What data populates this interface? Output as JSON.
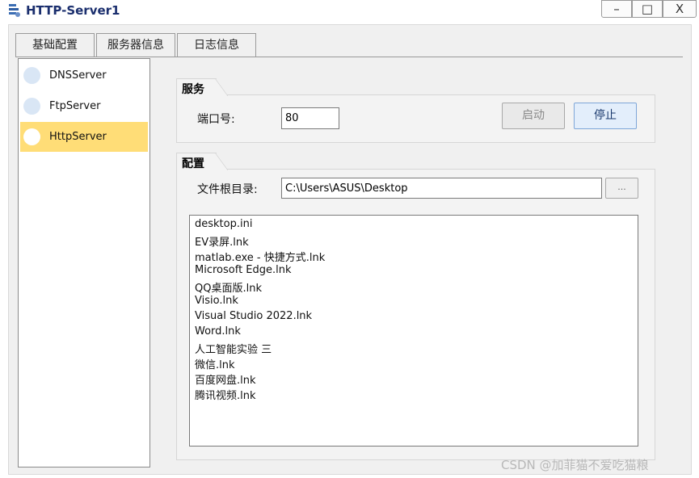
{
  "window": {
    "title": "HTTP-Server1",
    "icon": "server-app-icon",
    "controls": {
      "minimize": "–",
      "maximize": "□",
      "close": "X"
    }
  },
  "tabs": [
    {
      "label": "基础配置",
      "active": true
    },
    {
      "label": "服务器信息",
      "active": false
    },
    {
      "label": "日志信息",
      "active": false
    }
  ],
  "servers": [
    {
      "label": "DNSServer",
      "selected": false
    },
    {
      "label": "FtpServer",
      "selected": false
    },
    {
      "label": "HttpServer",
      "selected": true
    }
  ],
  "service": {
    "title": "服务",
    "port_label": "端口号:",
    "port_value": "80",
    "start_label": "启动",
    "stop_label": "停止"
  },
  "config": {
    "title": "配置",
    "root_label": "文件根目录:",
    "root_value": "C:\\Users\\ASUS\\Desktop",
    "browse_label": "...",
    "files": [
      "desktop.ini",
      "EV录屏.lnk",
      "matlab.exe - 快捷方式.lnk",
      "Microsoft Edge.lnk",
      "QQ桌面版.lnk",
      "Visio.lnk",
      "Visual Studio 2022.lnk",
      "Word.lnk",
      "人工智能实验 三",
      "微信.lnk",
      "百度网盘.lnk",
      "腾讯视频.lnk"
    ]
  },
  "watermark": "CSDN @加菲猫不爱吃猫粮",
  "colors": {
    "selected": "#ffdd77",
    "title": "#1b2f6e",
    "accent_button": "#e3eefb"
  }
}
